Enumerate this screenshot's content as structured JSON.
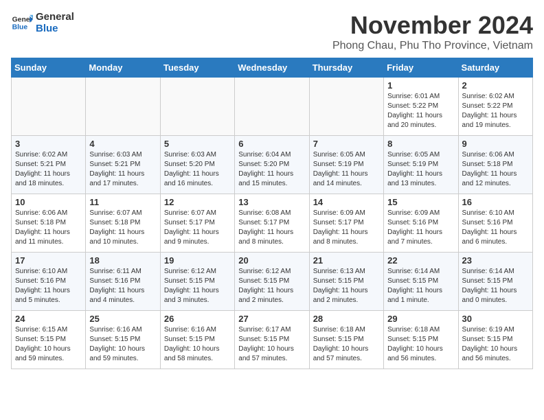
{
  "logo": {
    "line1": "General",
    "line2": "Blue"
  },
  "title": "November 2024",
  "subtitle": "Phong Chau, Phu Tho Province, Vietnam",
  "days_of_week": [
    "Sunday",
    "Monday",
    "Tuesday",
    "Wednesday",
    "Thursday",
    "Friday",
    "Saturday"
  ],
  "weeks": [
    [
      {
        "day": "",
        "info": ""
      },
      {
        "day": "",
        "info": ""
      },
      {
        "day": "",
        "info": ""
      },
      {
        "day": "",
        "info": ""
      },
      {
        "day": "",
        "info": ""
      },
      {
        "day": "1",
        "info": "Sunrise: 6:01 AM\nSunset: 5:22 PM\nDaylight: 11 hours and 20 minutes."
      },
      {
        "day": "2",
        "info": "Sunrise: 6:02 AM\nSunset: 5:22 PM\nDaylight: 11 hours and 19 minutes."
      }
    ],
    [
      {
        "day": "3",
        "info": "Sunrise: 6:02 AM\nSunset: 5:21 PM\nDaylight: 11 hours and 18 minutes."
      },
      {
        "day": "4",
        "info": "Sunrise: 6:03 AM\nSunset: 5:21 PM\nDaylight: 11 hours and 17 minutes."
      },
      {
        "day": "5",
        "info": "Sunrise: 6:03 AM\nSunset: 5:20 PM\nDaylight: 11 hours and 16 minutes."
      },
      {
        "day": "6",
        "info": "Sunrise: 6:04 AM\nSunset: 5:20 PM\nDaylight: 11 hours and 15 minutes."
      },
      {
        "day": "7",
        "info": "Sunrise: 6:05 AM\nSunset: 5:19 PM\nDaylight: 11 hours and 14 minutes."
      },
      {
        "day": "8",
        "info": "Sunrise: 6:05 AM\nSunset: 5:19 PM\nDaylight: 11 hours and 13 minutes."
      },
      {
        "day": "9",
        "info": "Sunrise: 6:06 AM\nSunset: 5:18 PM\nDaylight: 11 hours and 12 minutes."
      }
    ],
    [
      {
        "day": "10",
        "info": "Sunrise: 6:06 AM\nSunset: 5:18 PM\nDaylight: 11 hours and 11 minutes."
      },
      {
        "day": "11",
        "info": "Sunrise: 6:07 AM\nSunset: 5:18 PM\nDaylight: 11 hours and 10 minutes."
      },
      {
        "day": "12",
        "info": "Sunrise: 6:07 AM\nSunset: 5:17 PM\nDaylight: 11 hours and 9 minutes."
      },
      {
        "day": "13",
        "info": "Sunrise: 6:08 AM\nSunset: 5:17 PM\nDaylight: 11 hours and 8 minutes."
      },
      {
        "day": "14",
        "info": "Sunrise: 6:09 AM\nSunset: 5:17 PM\nDaylight: 11 hours and 8 minutes."
      },
      {
        "day": "15",
        "info": "Sunrise: 6:09 AM\nSunset: 5:16 PM\nDaylight: 11 hours and 7 minutes."
      },
      {
        "day": "16",
        "info": "Sunrise: 6:10 AM\nSunset: 5:16 PM\nDaylight: 11 hours and 6 minutes."
      }
    ],
    [
      {
        "day": "17",
        "info": "Sunrise: 6:10 AM\nSunset: 5:16 PM\nDaylight: 11 hours and 5 minutes."
      },
      {
        "day": "18",
        "info": "Sunrise: 6:11 AM\nSunset: 5:16 PM\nDaylight: 11 hours and 4 minutes."
      },
      {
        "day": "19",
        "info": "Sunrise: 6:12 AM\nSunset: 5:15 PM\nDaylight: 11 hours and 3 minutes."
      },
      {
        "day": "20",
        "info": "Sunrise: 6:12 AM\nSunset: 5:15 PM\nDaylight: 11 hours and 2 minutes."
      },
      {
        "day": "21",
        "info": "Sunrise: 6:13 AM\nSunset: 5:15 PM\nDaylight: 11 hours and 2 minutes."
      },
      {
        "day": "22",
        "info": "Sunrise: 6:14 AM\nSunset: 5:15 PM\nDaylight: 11 hours and 1 minute."
      },
      {
        "day": "23",
        "info": "Sunrise: 6:14 AM\nSunset: 5:15 PM\nDaylight: 11 hours and 0 minutes."
      }
    ],
    [
      {
        "day": "24",
        "info": "Sunrise: 6:15 AM\nSunset: 5:15 PM\nDaylight: 10 hours and 59 minutes."
      },
      {
        "day": "25",
        "info": "Sunrise: 6:16 AM\nSunset: 5:15 PM\nDaylight: 10 hours and 59 minutes."
      },
      {
        "day": "26",
        "info": "Sunrise: 6:16 AM\nSunset: 5:15 PM\nDaylight: 10 hours and 58 minutes."
      },
      {
        "day": "27",
        "info": "Sunrise: 6:17 AM\nSunset: 5:15 PM\nDaylight: 10 hours and 57 minutes."
      },
      {
        "day": "28",
        "info": "Sunrise: 6:18 AM\nSunset: 5:15 PM\nDaylight: 10 hours and 57 minutes."
      },
      {
        "day": "29",
        "info": "Sunrise: 6:18 AM\nSunset: 5:15 PM\nDaylight: 10 hours and 56 minutes."
      },
      {
        "day": "30",
        "info": "Sunrise: 6:19 AM\nSunset: 5:15 PM\nDaylight: 10 hours and 56 minutes."
      }
    ]
  ]
}
